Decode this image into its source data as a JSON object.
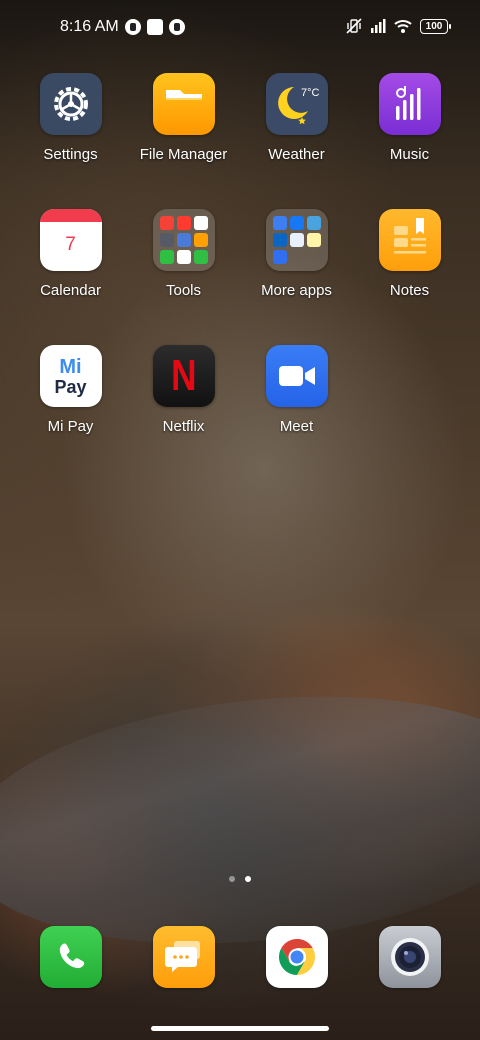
{
  "status_bar": {
    "time": "8:16 AM",
    "battery": "100"
  },
  "apps": [
    {
      "label": "Settings",
      "icon": "settings-icon"
    },
    {
      "label": "File Manager",
      "icon": "folder-icon"
    },
    {
      "label": "Weather",
      "icon": "weather-moon-icon",
      "temperature": "7°C"
    },
    {
      "label": "Music",
      "icon": "music-icon"
    },
    {
      "label": "Calendar",
      "icon": "calendar-icon",
      "day": "7"
    },
    {
      "label": "Tools",
      "icon": "folder-tools-icon"
    },
    {
      "label": "More apps",
      "icon": "folder-more-apps-icon"
    },
    {
      "label": "Notes",
      "icon": "notes-icon"
    },
    {
      "label": "Mi Pay",
      "icon": "mi-pay-icon",
      "logo_top": "Mi",
      "logo_bottom": "Pay"
    },
    {
      "label": "Netflix",
      "icon": "netflix-icon",
      "logo": "N"
    },
    {
      "label": "Meet",
      "icon": "meet-camera-icon"
    }
  ],
  "page_indicator": {
    "count": 2,
    "active_index": 1
  },
  "dock": [
    {
      "name": "phone",
      "icon": "phone-icon"
    },
    {
      "name": "messages",
      "icon": "messages-icon"
    },
    {
      "name": "chrome",
      "icon": "chrome-icon"
    },
    {
      "name": "camera",
      "icon": "camera-icon"
    }
  ],
  "colors": {
    "settings_bg": "#3a4a62",
    "file_manager": "#ffb300",
    "weather_bg": "#3b4a66",
    "music": "#8e3bdc",
    "calendar_red": "#f03c4c",
    "notes": "#ffae1a",
    "netflix_red": "#e50914",
    "meet_blue": "#2f6ff0",
    "phone_green": "#2fbf43",
    "messages_orange": "#ffab1a"
  }
}
